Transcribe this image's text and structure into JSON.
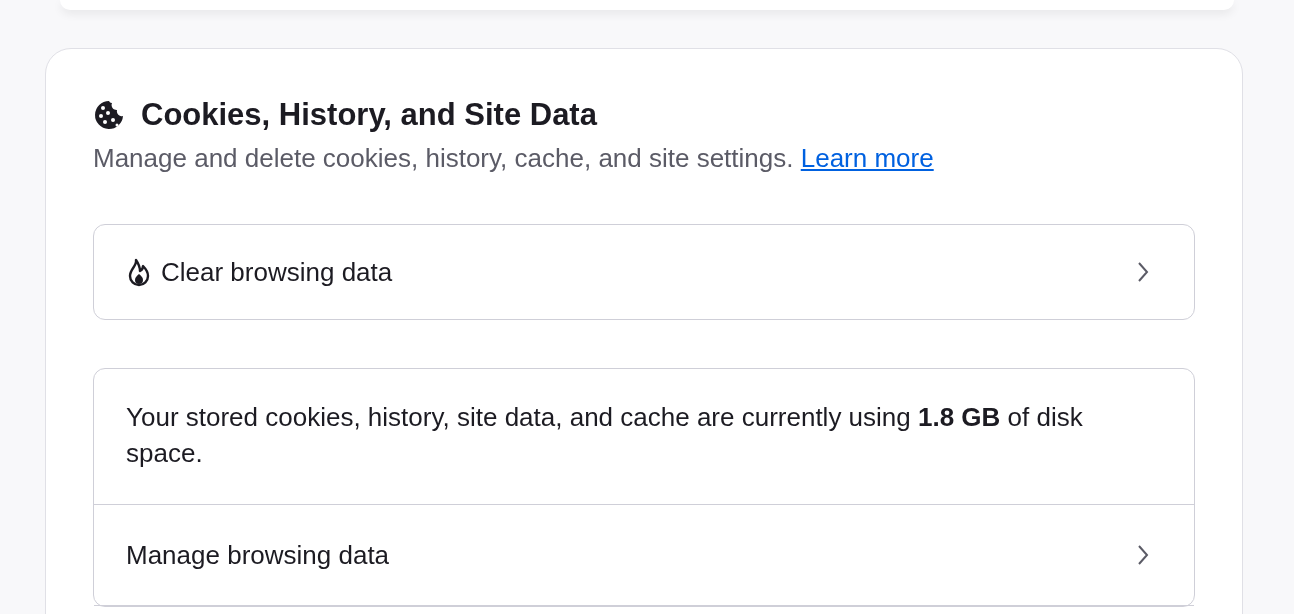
{
  "section": {
    "title": "Cookies, History, and Site Data",
    "description": "Manage and delete cookies, history, cache, and site settings.",
    "link": "Learn more"
  },
  "action": {
    "label": "Clear browsing data"
  },
  "storage": {
    "items": [
      {
        "kind": "info",
        "text": "Your stored cookies, history, site data, and cache are currently using **1.8 GB** of disk space."
      },
      {
        "kind": "nav",
        "text": "Manage browsing data"
      }
    ]
  }
}
